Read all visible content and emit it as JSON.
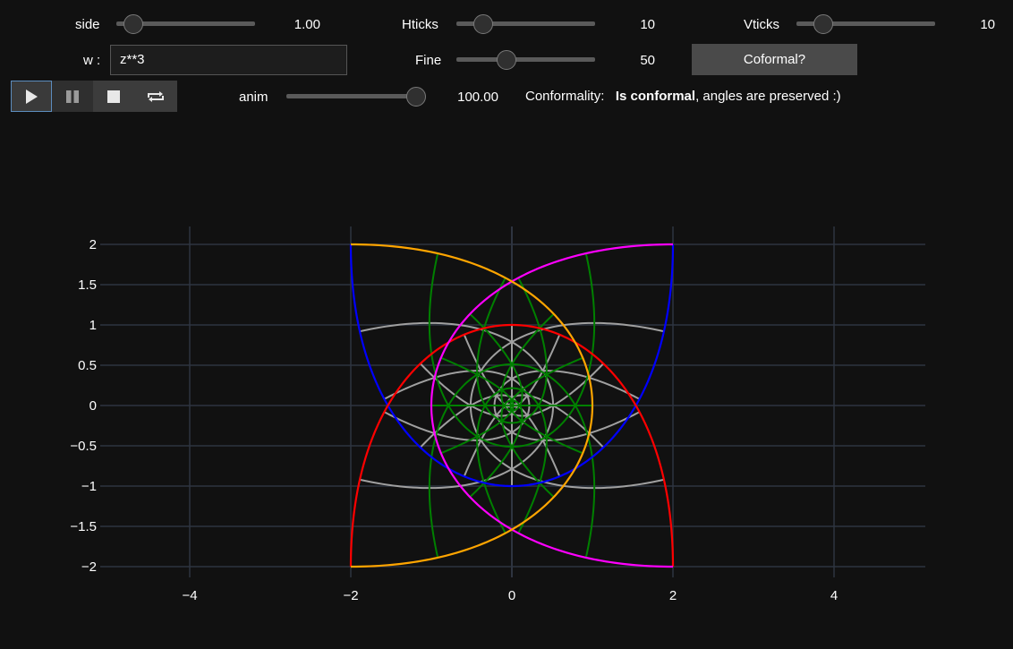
{
  "controls": {
    "side": {
      "label": "side",
      "value": "1.00",
      "fraction": 0.0
    },
    "hticks": {
      "label": "Hticks",
      "value": "10",
      "fraction": 0.09
    },
    "vticks": {
      "label": "Vticks",
      "value": "10",
      "fraction": 0.09
    },
    "w": {
      "label": "w :",
      "value": "z**3"
    },
    "fine": {
      "label": "Fine",
      "value": "50",
      "fraction": 0.29
    },
    "conformal_button": "Coformal?",
    "anim": {
      "label": "anim",
      "value": "100.00",
      "fraction": 1.0
    },
    "conformality_label": "Conformality:",
    "conformality_bold": "Is conformal",
    "conformality_rest": ", angles are preserved :)"
  },
  "player": {
    "buttons": [
      "play-icon",
      "pause-icon",
      "stop-icon",
      "loop-icon"
    ],
    "active": "play-icon"
  },
  "colors": {
    "background": "#111111",
    "grid": "#2e3440",
    "blue": "#0000ff",
    "red": "#ff0000",
    "magenta": "#ff00ff",
    "orange": "#ffa500",
    "green": "#008000",
    "gray": "#a0a0a0"
  },
  "chart_data": {
    "type": "line",
    "description_of_curves": "image of square grid |x|,|y|<=1 under w = z^3",
    "xlim": [
      -5.15,
      5.15
    ],
    "ylim": [
      -2.2,
      2.2
    ],
    "x_ticks": [
      "−4",
      "−2",
      "0",
      "2",
      "4"
    ],
    "x_tick_values": [
      -4,
      -2,
      0,
      2,
      4
    ],
    "y_ticks": [
      "2",
      "1.5",
      "1",
      "0.5",
      "0",
      "−0.5",
      "−1",
      "−1.5",
      "−2"
    ],
    "y_tick_values": [
      2,
      1.5,
      1,
      0.5,
      0,
      -0.5,
      -1,
      -1.5,
      -2
    ],
    "grid": true,
    "series": [
      {
        "color": "blue",
        "edge": "top",
        "function": "z^3",
        "side": 1
      },
      {
        "color": "red",
        "edge": "bottom",
        "function": "z^3",
        "side": 1
      },
      {
        "color": "magenta",
        "edge": "left",
        "function": "z^3",
        "side": 1
      },
      {
        "color": "orange",
        "edge": "right",
        "function": "z^3",
        "side": 1
      },
      {
        "color": "gray",
        "family": "vertical interior lines",
        "count": 9
      },
      {
        "color": "green",
        "family": "horizontal interior lines",
        "count": 9
      }
    ]
  }
}
